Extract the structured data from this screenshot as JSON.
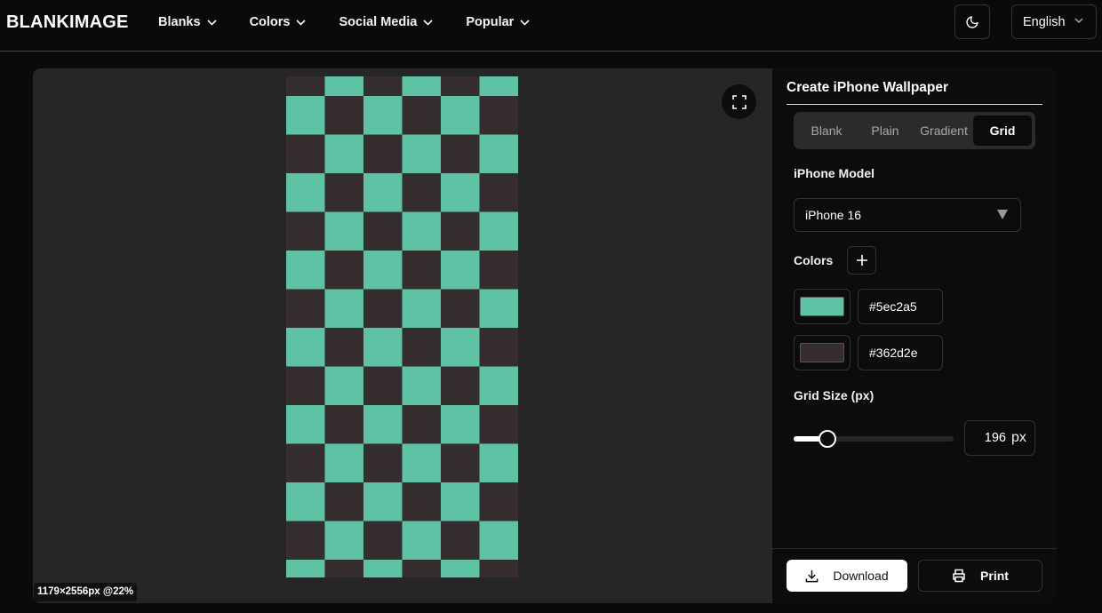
{
  "header": {
    "logo": "BLANKIMAGE",
    "nav": [
      {
        "label": "Blanks",
        "icon": "chevron-down-icon"
      },
      {
        "label": "Colors",
        "icon": "chevron-down-icon"
      },
      {
        "label": "Social Media",
        "icon": "chevron-down-icon"
      },
      {
        "label": "Popular",
        "icon": "chevron-down-icon"
      }
    ],
    "theme_icon": "moon-icon",
    "language": "English"
  },
  "preview": {
    "dimensions_badge": "1179×2556px @22%",
    "fullscreen_icon": "fullscreen-icon"
  },
  "panel": {
    "title": "Create iPhone Wallpaper",
    "tabs": [
      {
        "label": "Blank",
        "active": false
      },
      {
        "label": "Plain",
        "active": false
      },
      {
        "label": "Gradient",
        "active": false
      },
      {
        "label": "Grid",
        "active": true
      }
    ],
    "model_label": "iPhone Model",
    "model_value": "iPhone 16",
    "colors_label": "Colors",
    "colors": [
      "#5ec2a5",
      "#362d2e"
    ],
    "grid_size_label": "Grid Size (px)",
    "grid_size_value": "196",
    "grid_size_unit": "px",
    "grid_size_slider_fraction": 0.21,
    "download_label": "Download",
    "print_label": "Print"
  }
}
